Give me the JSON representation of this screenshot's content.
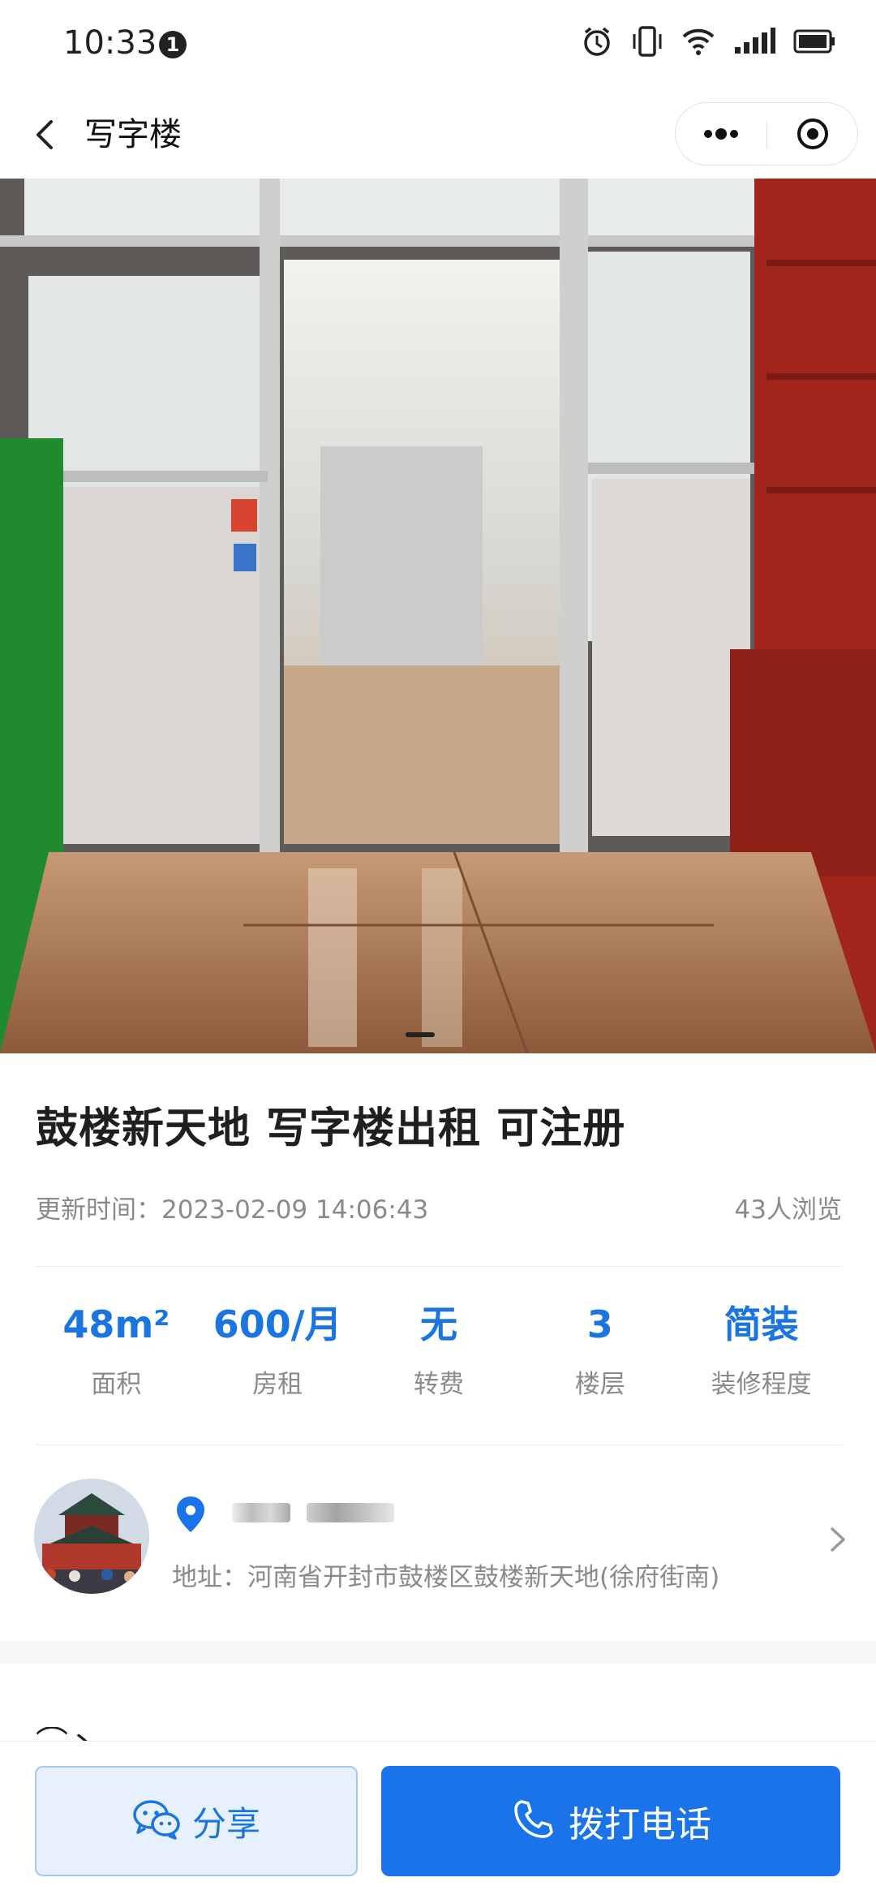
{
  "status_bar": {
    "time": "10:33",
    "notification_count": "1",
    "icons": [
      "alarm-icon",
      "vibrate-icon",
      "wifi-icon",
      "signal-icon",
      "battery-icon"
    ]
  },
  "nav": {
    "title": "写字楼",
    "icons": [
      "back-icon",
      "more-icon",
      "close-target-icon"
    ]
  },
  "listing": {
    "title": "鼓楼新天地 写字楼出租 可注册",
    "update_label": "更新时间：",
    "update_time": "2023-02-09 14:06:43",
    "views": "43人浏览",
    "photo_index": 1
  },
  "stats": [
    {
      "value": "48m²",
      "label": "面积"
    },
    {
      "value": "600/月",
      "label": "房租"
    },
    {
      "value": "无",
      "label": "转费"
    },
    {
      "value": "3",
      "label": "楼层"
    },
    {
      "value": "简装",
      "label": "装修程度"
    }
  ],
  "location": {
    "address": "地址：河南省开封市鼓楼区鼓楼新天地(徐府街南)"
  },
  "next_section_partial": "⌒丶",
  "actions": {
    "share_label": "分享",
    "call_label": "拨打电话"
  },
  "colors": {
    "accent": "#1a73e8",
    "stat_value": "#1b75e0",
    "share_bg": "#e7f1fe",
    "muted_text": "#8a8a8a"
  }
}
